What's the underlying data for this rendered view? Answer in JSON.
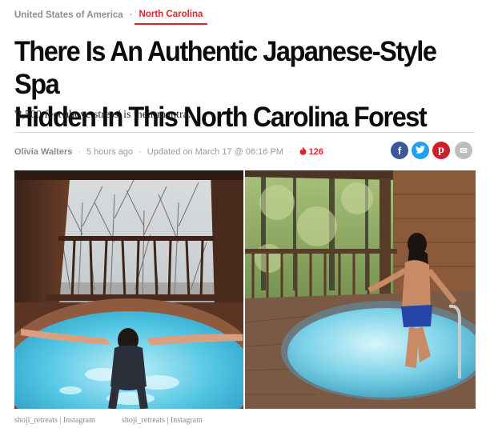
{
  "breadcrumb": {
    "parent": "United States of America",
    "separator": "·",
    "current": "North Carolina"
  },
  "article": {
    "title_line1": "There Is An Authentic Japanese-Style Spa",
    "title_line2": "Hidden In This North Carolina Forest",
    "subtitle": "'2,500 feet above stress' is their mantra."
  },
  "meta": {
    "author": "Olivia Walters",
    "time_ago": "5 hours ago",
    "updated": "Updated on March 17 @ 06:16 PM",
    "separator": "·",
    "reactions": "126"
  },
  "share": {
    "facebook": "f",
    "twitter": "t",
    "pinterest": "p",
    "email": "✉"
  },
  "colors": {
    "accent": "#e0232e",
    "facebook": "#3b5998",
    "twitter": "#1da1f2",
    "pinterest": "#cb2027",
    "email": "#bdbdbd"
  },
  "photos": [
    {
      "credit": "shoji_retreats | Instagram"
    },
    {
      "credit": "shoji_retreats | Instagram"
    }
  ]
}
